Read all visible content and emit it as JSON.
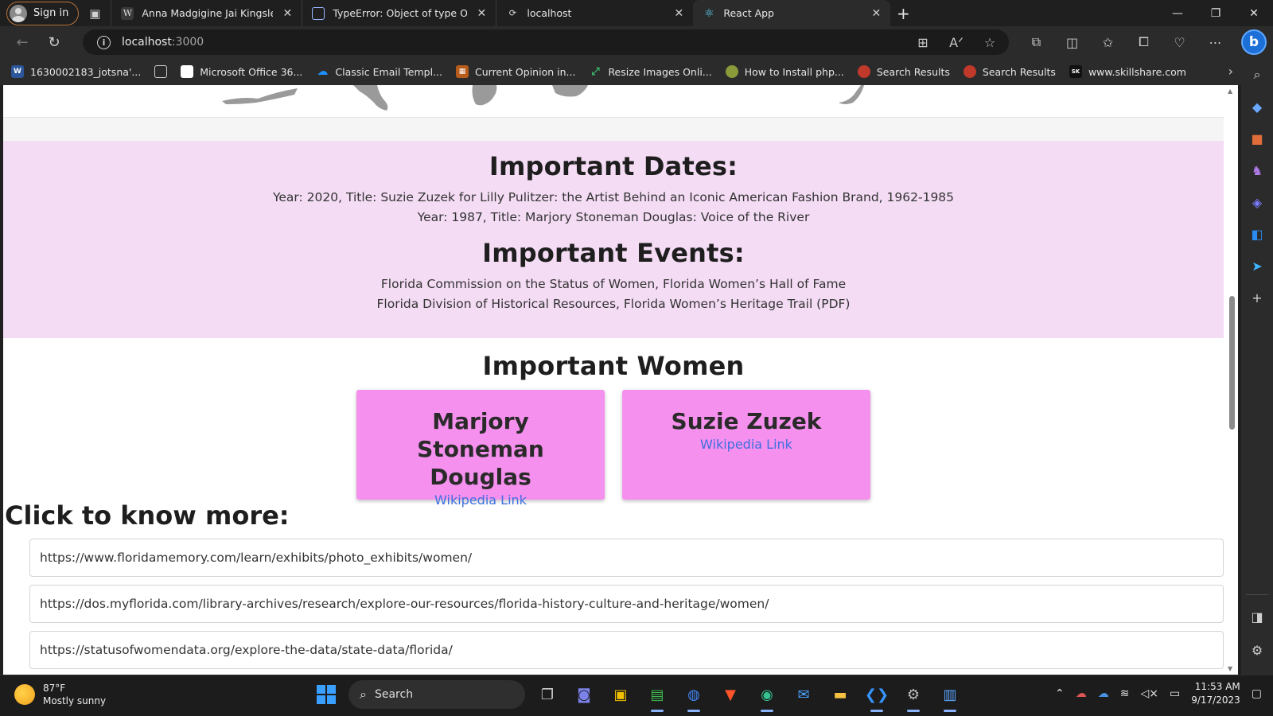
{
  "browser": {
    "sign_in_label": "Sign in",
    "tabs": [
      {
        "title": "Anna Madgigine Jai Kingsley' - W",
        "icon": "W"
      },
      {
        "title": "TypeError: Object of type Object",
        "icon": "▭"
      },
      {
        "title": "localhost",
        "icon": "⟳"
      },
      {
        "title": "React App",
        "icon": "⚛"
      }
    ],
    "url_host": "localhost",
    "url_port": ":3000",
    "bookmarks": [
      {
        "label": "1630002183_jotsna'...",
        "icon": "W",
        "color": "#2b579a"
      },
      {
        "label": "",
        "icon": "▯",
        "color": "#2b2b2b"
      },
      {
        "label": "Microsoft Office 36...",
        "icon": "",
        "color": "#ffffff"
      },
      {
        "label": "Classic Email Templ...",
        "icon": "☁",
        "color": "#2b2b2b"
      },
      {
        "label": "Current Opinion in...",
        "icon": "▦",
        "color": "#b85c1b"
      },
      {
        "label": "Resize Images Onli...",
        "icon": "⤢",
        "color": "#2b2b2b"
      },
      {
        "label": "How to Install php...",
        "icon": "◉",
        "color": "#8a9a3a"
      },
      {
        "label": "Search Results",
        "icon": "◉",
        "color": "#c0392b"
      },
      {
        "label": "Search Results",
        "icon": "◉",
        "color": "#c0392b"
      },
      {
        "label": "www.skillshare.com",
        "icon": "SK",
        "color": "#1c1c1c"
      }
    ]
  },
  "page": {
    "dates_heading": "Important Dates:",
    "dates": [
      "Year: 2020, Title: Suzie Zuzek for Lilly Pulitzer: the Artist Behind an Iconic American Fashion Brand, 1962-1985",
      "Year: 1987, Title: Marjory Stoneman Douglas: Voice of the River"
    ],
    "events_heading": "Important Events:",
    "events": [
      "Florida Commission on the Status of Women, Florida Women’s Hall of Fame",
      "Florida Division of Historical Resources, Florida Women’s Heritage Trail (PDF)"
    ],
    "women_heading": "Important Women",
    "women": [
      {
        "name": "Marjory Stoneman Douglas",
        "link": "Wikipedia Link"
      },
      {
        "name": "Suzie Zuzek",
        "link": "Wikipedia Link"
      }
    ],
    "more_heading": "Click to know more:",
    "links": [
      "https://www.floridamemory.com/learn/exhibits/photo_exhibits/women/",
      "https://dos.myflorida.com/library-archives/research/explore-our-resources/florida-history-culture-and-heritage/women/",
      "https://statusofwomendata.org/explore-the-data/state-data/florida/"
    ]
  },
  "taskbar": {
    "temperature": "87°F",
    "weather": "Mostly sunny",
    "search_label": "Search",
    "time": "11:53 AM",
    "date": "9/17/2023"
  }
}
